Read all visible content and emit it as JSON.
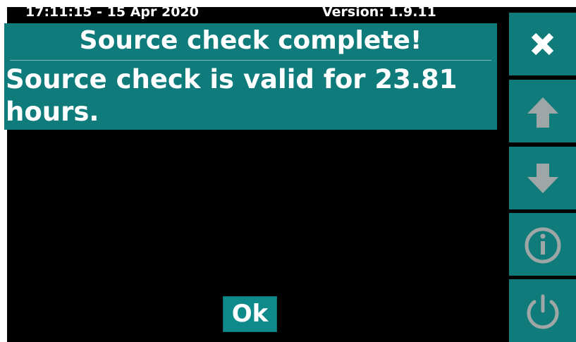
{
  "status_bar": {
    "clock": "17:11:15 - 15 Apr 2020",
    "version": "Version: 1.9.11"
  },
  "dialog": {
    "title": "Source check complete!",
    "message": "Source check is valid for 23.81 hours."
  },
  "ok_button": {
    "label": "Ok"
  },
  "side_buttons": [
    {
      "icon": "close-icon",
      "enabled": true
    },
    {
      "icon": "arrow-up-icon",
      "enabled": false
    },
    {
      "icon": "arrow-down-icon",
      "enabled": false
    },
    {
      "icon": "info-icon",
      "enabled": false
    },
    {
      "icon": "power-icon",
      "enabled": false
    }
  ],
  "colors": {
    "panel_teal": "#0f7b7b",
    "background": "#000000",
    "text": "#ffffff",
    "disabled_icon": "#9fa6a6"
  }
}
